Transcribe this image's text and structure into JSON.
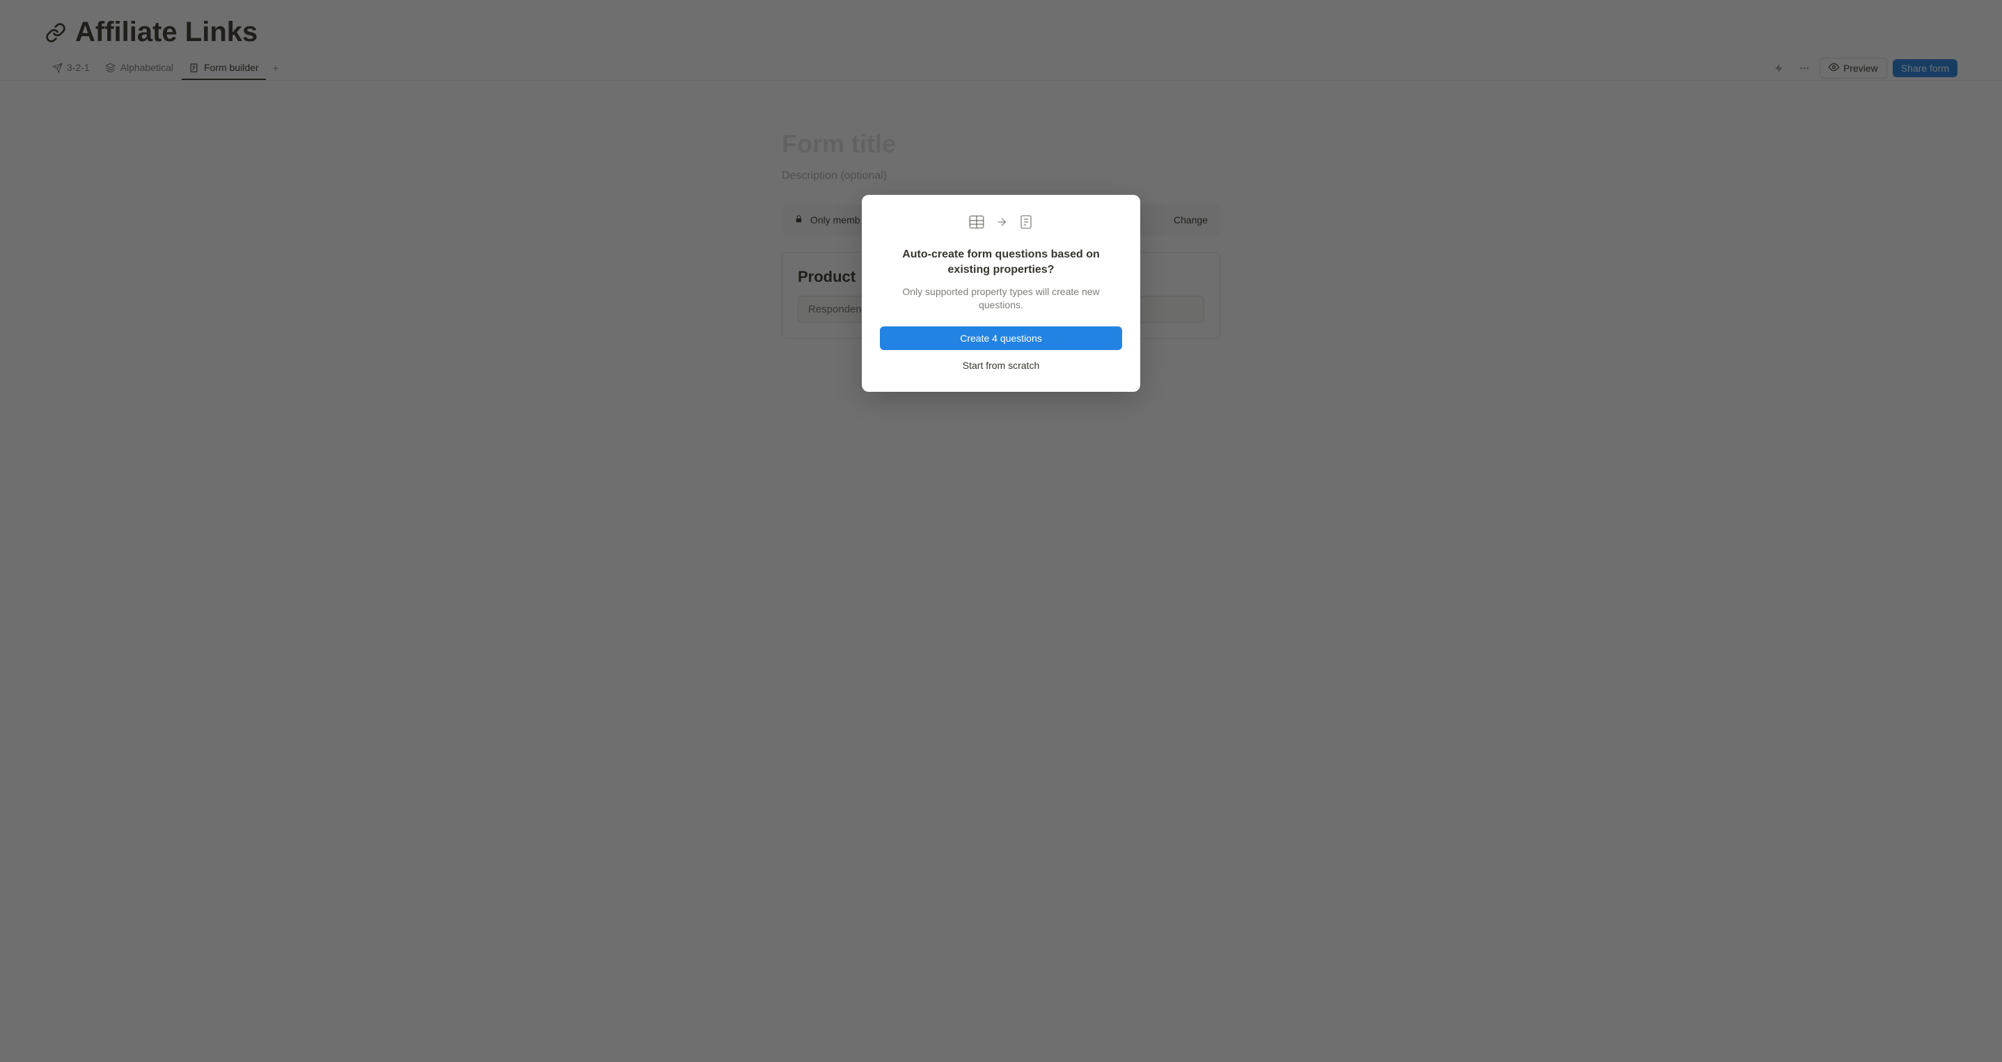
{
  "page": {
    "title": "Affiliate Links"
  },
  "tabs": {
    "items": [
      {
        "label": "3-2-1"
      },
      {
        "label": "Alphabetical"
      },
      {
        "label": "Form builder"
      }
    ]
  },
  "actions": {
    "preview": "Preview",
    "share": "Share form"
  },
  "form": {
    "title_placeholder": "Form title",
    "description_placeholder": "Description (optional)",
    "access_text": "Only memb",
    "change": "Change",
    "question_label": "Product",
    "question_placeholder": "Respondent"
  },
  "modal": {
    "title": "Auto-create form questions based on existing properties?",
    "subtitle": "Only supported property types will create new questions.",
    "primary": "Create 4 questions",
    "secondary": "Start from scratch"
  }
}
